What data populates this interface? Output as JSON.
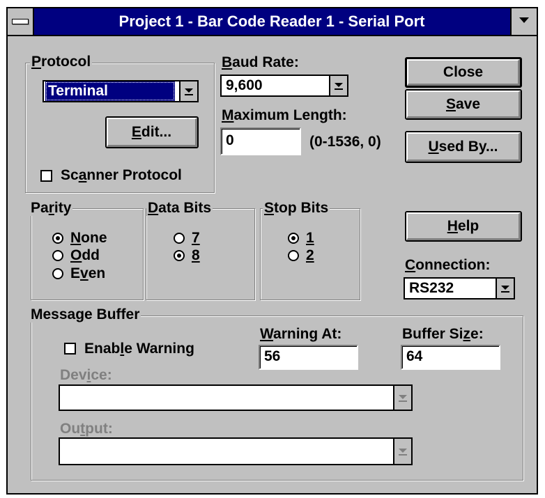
{
  "window": {
    "title": "Project 1 - Bar Code Reader 1 - Serial Port"
  },
  "protocol": {
    "group_label_prefix": "P",
    "group_label_rest": "rotocol",
    "selected": "Terminal",
    "edit_button_pre": "",
    "edit_button_u": "E",
    "edit_button_post": "dit...",
    "scanner_checkbox_pre": "Sc",
    "scanner_checkbox_u": "a",
    "scanner_checkbox_post": "nner Protocol",
    "scanner_checked": false
  },
  "baud": {
    "label_u": "B",
    "label_rest": "aud Rate:",
    "value": "9,600"
  },
  "max_length": {
    "label_u": "M",
    "label_rest": "aximum Length:",
    "value": "0",
    "hint": "(0-1536, 0)"
  },
  "buttons": {
    "close": "Close",
    "save_u": "S",
    "save_rest": "ave",
    "used_by_u": "U",
    "used_by_rest": "sed By...",
    "help_u": "H",
    "help_rest": "elp"
  },
  "parity": {
    "label_pre": "Pa",
    "label_u": "r",
    "label_post": "ity",
    "options": [
      {
        "pre": "",
        "u": "N",
        "post": "one",
        "selected": true
      },
      {
        "pre": "",
        "u": "O",
        "post": "dd",
        "selected": false
      },
      {
        "pre": "E",
        "u": "v",
        "post": "en",
        "selected": false
      }
    ]
  },
  "data_bits": {
    "label_u": "D",
    "label_rest": "ata Bits",
    "options": [
      {
        "u": "7",
        "selected": false
      },
      {
        "u": "8",
        "selected": true
      }
    ]
  },
  "stop_bits": {
    "label_u": "S",
    "label_rest": "top Bits",
    "options": [
      {
        "u": "1",
        "selected": true
      },
      {
        "u": "2",
        "selected": false
      }
    ]
  },
  "connection": {
    "label_u": "C",
    "label_rest": "onnection:",
    "value": "RS232"
  },
  "message_buffer": {
    "label_pre": "Messa",
    "label_u": "g",
    "label_post": "e Buffer",
    "enable_warning_pre": "Enab",
    "enable_warning_u": "l",
    "enable_warning_post": "e Warning",
    "enable_warning_checked": false,
    "warning_at_u": "W",
    "warning_at_rest": "arning At:",
    "warning_at_value": "56",
    "buffer_size_pre": "Buffer Si",
    "buffer_size_u": "z",
    "buffer_size_post": "e:",
    "buffer_size_value": "64",
    "device_pre": "Dev",
    "device_u": "i",
    "device_post": "ce:",
    "device_value": "",
    "output_pre": "Ou",
    "output_u": "t",
    "output_post": "put:",
    "output_value": ""
  },
  "icons": {
    "system_menu": "system-menu-icon",
    "minimize": "down-arrow-icon",
    "dropdown": "dropdown-arrow-icon"
  },
  "colors": {
    "title_bar": "#000080",
    "face": "#c0c0c0",
    "disabled_text": "#808080"
  }
}
